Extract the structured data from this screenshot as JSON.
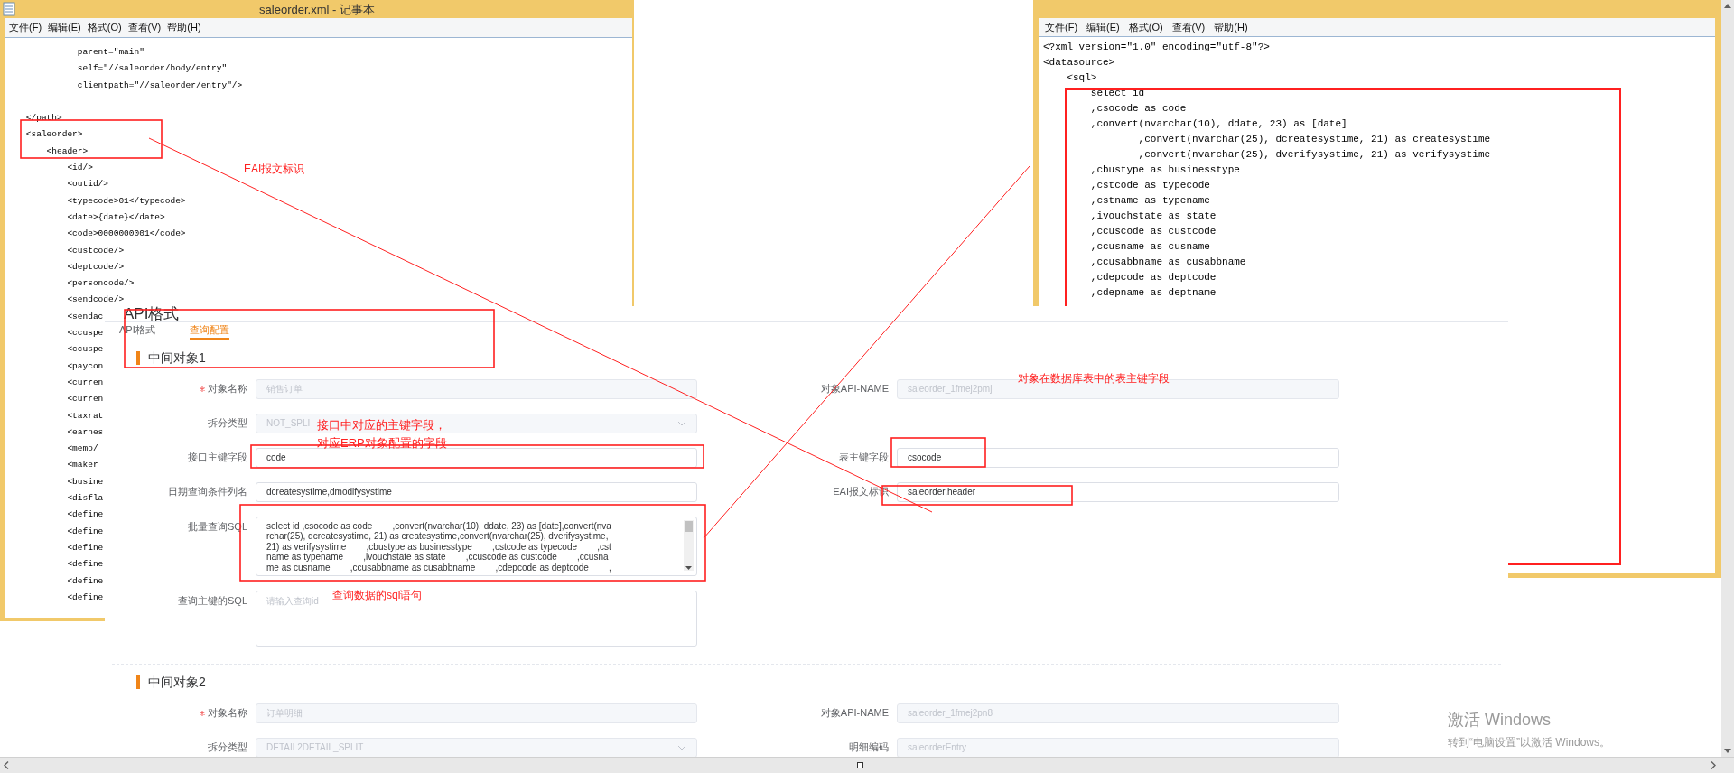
{
  "notepad_left": {
    "title": "saleorder.xml - 记事本",
    "menu": [
      "文件(F)",
      "编辑(E)",
      "格式(O)",
      "查看(V)",
      "帮助(H)"
    ],
    "blocks": [
      [
        "              parent=\"main\"",
        "              self=\"//saleorder/body/entry\"",
        "              clientpath=\"//saleorder/entry\"/>"
      ],
      [
        "    </path>",
        "    <saleorder>",
        "        <header>",
        "            <id/>",
        "            <outid/>",
        "            <typecode>01</typecode>",
        "            <date>{date}</date>",
        "            <code>0000000001</code>",
        "            <custcode/>",
        "            <deptcode/>",
        "            <personcode/>",
        "            <sendcode/>",
        "            <sendac",
        "            <ccuspe",
        "            <ccuspe",
        "            <paycon",
        "            <curren",
        "            <curren",
        "            <taxrat",
        "            <earnes",
        "            <memo/",
        "            <maker",
        "            <busine",
        "            <disfla",
        "            <define",
        "            <define",
        "            <define",
        "            <define",
        "            <define",
        "            <define"
      ]
    ]
  },
  "notepad_right": {
    "menu": [
      "文件(F)",
      "编辑(E)",
      "格式(O)",
      "查看(V)",
      "帮助(H)"
    ],
    "lines": [
      "<?xml version=\"1.0\" encoding=\"utf-8\"?>",
      "<datasource>",
      "    <sql>",
      "        select id",
      "        ,csocode as code",
      "        ,convert(nvarchar(10), ddate, 23) as [date]",
      "                ,convert(nvarchar(25), dcreatesystime, 21) as createsystime",
      "                ,convert(nvarchar(25), dverifysystime, 21) as verifysystime",
      "        ,cbustype as businesstype",
      "        ,cstcode as typecode",
      "        ,cstname as typename",
      "        ,ivouchstate as state",
      "        ,ccuscode as custcode",
      "        ,ccusname as cusname",
      "        ,ccusabbname as cusabbname",
      "        ,cdepcode as deptcode",
      "        ,cdepname as deptname"
    ]
  },
  "form": {
    "title": "API格式",
    "tabs": [
      {
        "label": "API格式",
        "selected": false
      },
      {
        "label": "查询配置",
        "selected": true
      }
    ],
    "sections": [
      {
        "title": "中间对象1",
        "rows": [
          [
            {
              "label": "对象名称",
              "required": true,
              "kind": "input",
              "value": "销售订单",
              "disabled": true
            },
            {
              "label": "对象API-NAME",
              "required": false,
              "kind": "input",
              "value": "saleorder_1fmej2pmj",
              "disabled": true
            }
          ],
          [
            {
              "label": "拆分类型",
              "required": false,
              "kind": "select",
              "value": "NOT_SPLI",
              "disabled": true
            }
          ],
          [
            {
              "label": "接口主键字段",
              "required": false,
              "kind": "input",
              "value": "code",
              "disabled": false
            },
            {
              "label": "表主键字段",
              "required": false,
              "kind": "input",
              "value": "csocode",
              "disabled": false
            }
          ],
          [
            {
              "label": "日期查询条件列名",
              "required": false,
              "kind": "input",
              "value": "dcreatesystime,dmodifysystime",
              "disabled": false
            },
            {
              "label": "EAI报文标识",
              "required": false,
              "kind": "input",
              "value": "saleorder.header",
              "disabled": false
            }
          ],
          [
            {
              "label": "批量查询SQL",
              "required": false,
              "kind": "textarea",
              "lines": [
                "select id ,csocode as code        ,convert(nvarchar(10), ddate, 23) as [date],convert(nva",
                "rchar(25), dcreatesystime, 21) as createsystime,convert(nvarchar(25), dverifysystime,",
                "21) as verifysystime        ,cbustype as businesstype        ,cstcode as typecode        ,cst",
                "name as typename        ,ivouchstate as state        ,ccuscode as custcode        ,ccusna",
                "me as cusname        ,ccusabbname as cusabbname        ,cdepcode as deptcode        ,"
              ],
              "scrollable": true
            }
          ],
          [
            {
              "label": "查询主键的SQL",
              "required": false,
              "kind": "textarea",
              "placeholder": "请输入查询id",
              "scrollable": false
            }
          ]
        ]
      },
      {
        "title": "中间对象2",
        "rows": [
          [
            {
              "label": "对象名称",
              "required": true,
              "kind": "input",
              "value": "订单明细",
              "disabled": true
            },
            {
              "label": "对象API-NAME",
              "required": false,
              "kind": "input",
              "value": "saleorder_1fmej2pn8",
              "disabled": true
            }
          ],
          [
            {
              "label": "拆分类型",
              "required": false,
              "kind": "select",
              "value": "DETAIL2DETAIL_SPLIT",
              "disabled": true
            },
            {
              "label": "明细编码",
              "required": false,
              "kind": "input",
              "value": "saleorderEntry",
              "disabled": true
            }
          ]
        ]
      }
    ]
  },
  "annotations": [
    {
      "text": "EAI报文标识"
    },
    {
      "text": "对象在数据库表中的表主键字段"
    },
    {
      "text": "接口中对应的主键字段，"
    },
    {
      "text": "对应ERP对象配置的字段"
    },
    {
      "text": "查询数据的sql语句"
    }
  ],
  "activation_notice": {
    "title": "激活 Windows",
    "text": "转到“电脑设置”以激活 Windows。"
  }
}
